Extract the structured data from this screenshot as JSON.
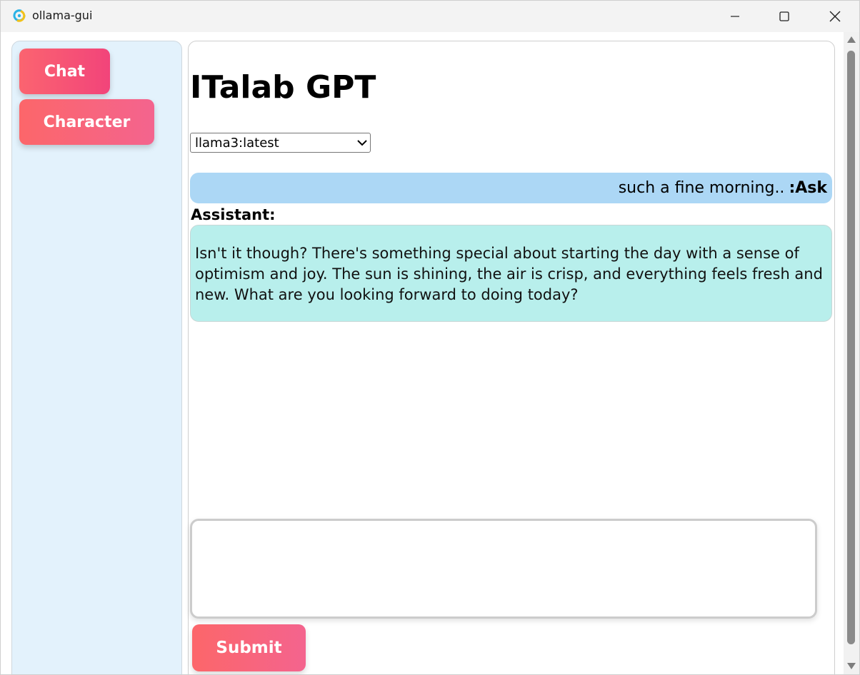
{
  "window": {
    "title": "ollama-gui",
    "app_icon": "ollama-app-icon",
    "controls": [
      "minimize-icon",
      "maximize-icon",
      "close-icon"
    ]
  },
  "sidebar": {
    "items": [
      {
        "label": "Chat"
      },
      {
        "label": "Character"
      }
    ]
  },
  "main": {
    "title": "ITalab GPT",
    "model_select": {
      "selected": "llama3:latest"
    },
    "messages": {
      "user": {
        "text": "such a fine morning..",
        "label": ":Ask"
      },
      "assistant": {
        "label": "Assistant:",
        "text": "Isn't it though? There's something special about starting the day with a sense of optimism and joy. The sun is shining, the air is crisp, and everything feels fresh and new. What are you looking forward to doing today?"
      }
    },
    "input": {
      "value": ""
    },
    "submit_label": "Submit"
  },
  "colors": {
    "button_gradient_start": "#fc666a",
    "button_gradient_end": "#f4648e",
    "sidebar_bg": "#e3f2fc",
    "user_bubble": "#acd7f5",
    "assistant_bubble": "#b8efec"
  }
}
